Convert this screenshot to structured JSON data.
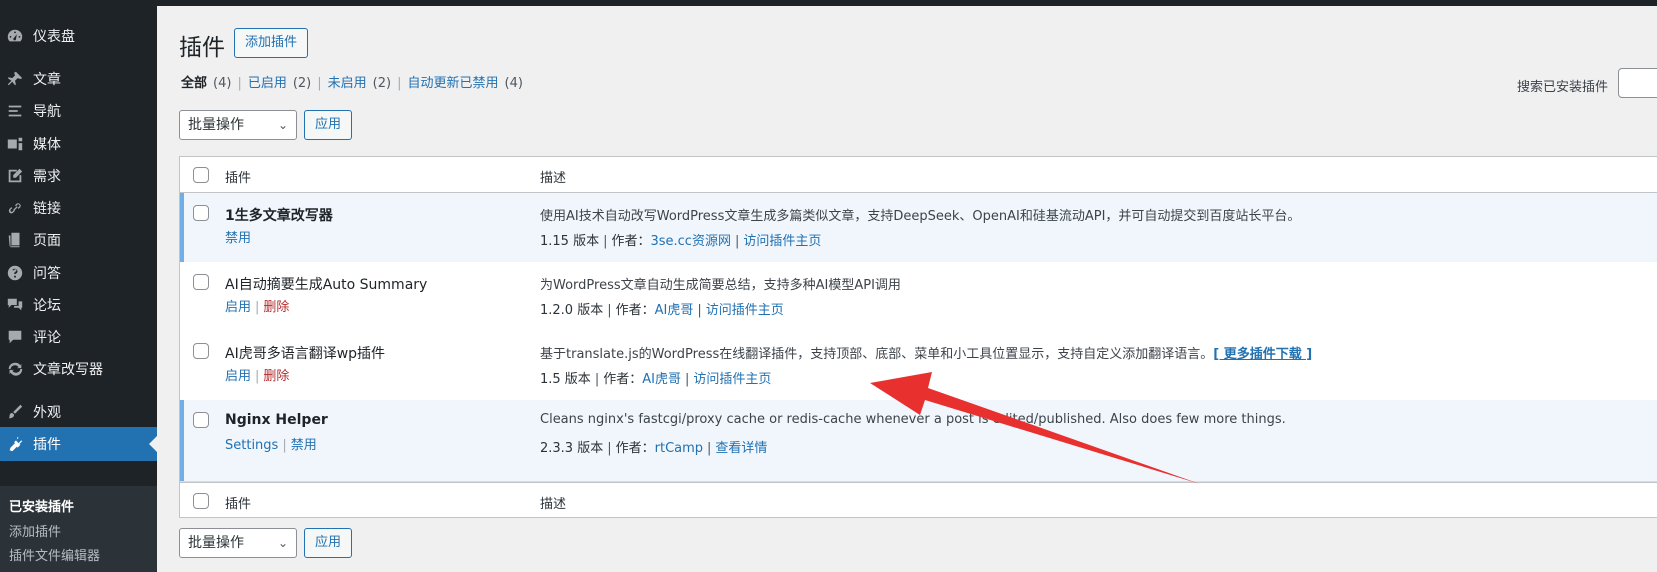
{
  "sidebar": {
    "items": [
      {
        "label": "仪表盘",
        "icon": "dashboard-icon"
      },
      {
        "label": "文章",
        "icon": "pin-icon"
      },
      {
        "label": "导航",
        "icon": "list-icon"
      },
      {
        "label": "媒体",
        "icon": "media-icon"
      },
      {
        "label": "需求",
        "icon": "edit-icon"
      },
      {
        "label": "链接",
        "icon": "link-icon"
      },
      {
        "label": "页面",
        "icon": "page-icon"
      },
      {
        "label": "问答",
        "icon": "question-icon"
      },
      {
        "label": "论坛",
        "icon": "forum-icon"
      },
      {
        "label": "评论",
        "icon": "comment-icon"
      },
      {
        "label": "文章改写器",
        "icon": "refresh-icon"
      },
      {
        "label": "外观",
        "icon": "brush-icon"
      },
      {
        "label": "插件",
        "icon": "plugin-icon"
      }
    ],
    "submenu": [
      "已安装插件",
      "添加插件",
      "插件文件编辑器"
    ]
  },
  "header": {
    "title": "插件",
    "add_button": "添加插件"
  },
  "filters": [
    {
      "label": "全部",
      "count": "(4)"
    },
    {
      "label": "已启用",
      "count": "(2)"
    },
    {
      "label": "未启用",
      "count": "(2)"
    },
    {
      "label": "自动更新已禁用",
      "count": "(4)"
    }
  ],
  "search": {
    "label": "搜索已安装插件"
  },
  "bulk": {
    "label": "批量操作",
    "apply": "应用"
  },
  "table": {
    "col_plugin": "插件",
    "col_desc": "描述",
    "rows": [
      {
        "name": "1生多文章改写器",
        "actions": [
          "禁用"
        ],
        "desc": "使用AI技术自动改写WordPress文章生成多篇类似文章，支持DeepSeek、OpenAI和硅基流动API，并可自动提交到百度站长平台。",
        "version": "1.15 版本",
        "author_label": "作者：",
        "author": "3se.cc资源网",
        "link": "访问插件主页"
      },
      {
        "name": "AI自动摘要生成Auto Summary",
        "actions": [
          "启用",
          "删除"
        ],
        "desc": "为WordPress文章自动生成简要总结，支持多种AI模型API调用",
        "version": "1.2.0 版本",
        "author_label": "作者：",
        "author": "AI虎哥",
        "link": "访问插件主页"
      },
      {
        "name": "AI虎哥多语言翻译wp插件",
        "actions": [
          "启用",
          "删除"
        ],
        "desc": "基于translate.js的WordPress在线翻译插件，支持顶部、底部、菜单和小工具位置显示，支持自定义添加翻译语言。",
        "desc_link": "[ 更多插件下载 ]",
        "version": "1.5 版本",
        "author_label": "作者：",
        "author": "AI虎哥",
        "link": "访问插件主页"
      },
      {
        "name": "Nginx Helper",
        "actions": [
          "Settings",
          "禁用"
        ],
        "desc": "Cleans nginx's fastcgi/proxy cache or redis-cache whenever a post is edited/published. Also does few more things.",
        "version": "2.3.3 版本",
        "author_label": "作者：",
        "author": "rtCamp",
        "link": "查看详情"
      }
    ]
  },
  "colors": {
    "accent": "#2271b1",
    "sidebar": "#1d2327",
    "arrow": "#e8312f"
  }
}
